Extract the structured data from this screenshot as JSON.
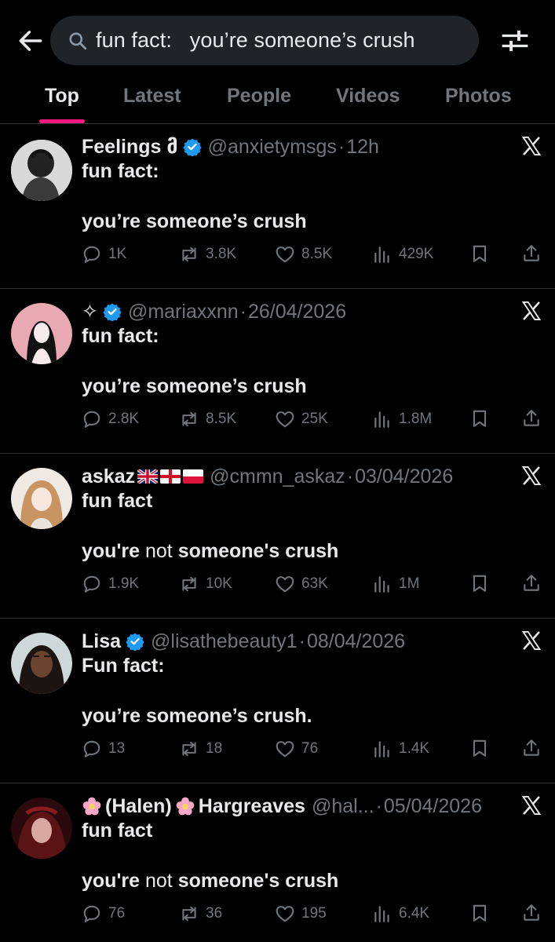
{
  "search": {
    "query": "fun fact:   you’re someone’s crush"
  },
  "tabs": [
    "Top",
    "Latest",
    "People",
    "Videos",
    "Photos"
  ],
  "active_tab": "Top",
  "colors": {
    "accent": "#f91880",
    "verified": "#1d9bf0",
    "muted": "#71767b",
    "text": "#e7e9ea"
  },
  "posts": [
    {
      "name": "Feelings მ",
      "verified": true,
      "handle": "@anxietymsgs",
      "time": "12h",
      "line1": "fun fact:",
      "line2": "you’re someone’s crush",
      "replies": "1K",
      "reposts": "3.8K",
      "likes": "8.5K",
      "views": "429K"
    },
    {
      "name": "✧",
      "verified": true,
      "handle": "@mariaxxnn",
      "time": "26/04/2026",
      "line1": "fun fact:",
      "line2": "you’re someone’s crush",
      "replies": "2.8K",
      "reposts": "8.5K",
      "likes": "25K",
      "views": "1.8M"
    },
    {
      "name": "askaz",
      "verified": false,
      "handle": "@cmmn_askaz",
      "time": "03/04/2026",
      "line1": "fun fact",
      "line2_a": "you're ",
      "line2_b": "not",
      "line2_c": " someone's crush",
      "replies": "1.9K",
      "reposts": "10K",
      "likes": "63K",
      "views": "1M"
    },
    {
      "name": "Lisa",
      "verified": true,
      "handle": "@lisathebeauty1",
      "time": "08/04/2026",
      "line1": "Fun fact:",
      "line2": "you’re someone’s crush.",
      "replies": "13",
      "reposts": "18",
      "likes": "76",
      "views": "1.4K"
    },
    {
      "name_a": "(Halen)",
      "name_b": "Hargreaves",
      "verified": false,
      "handle": "@hal...",
      "time": "05/04/2026",
      "line1": "fun fact",
      "line2_a": "you're ",
      "line2_b": "not",
      "line2_c": " someone's crush",
      "replies": "76",
      "reposts": "36",
      "likes": "195",
      "views": "6.4K"
    }
  ]
}
